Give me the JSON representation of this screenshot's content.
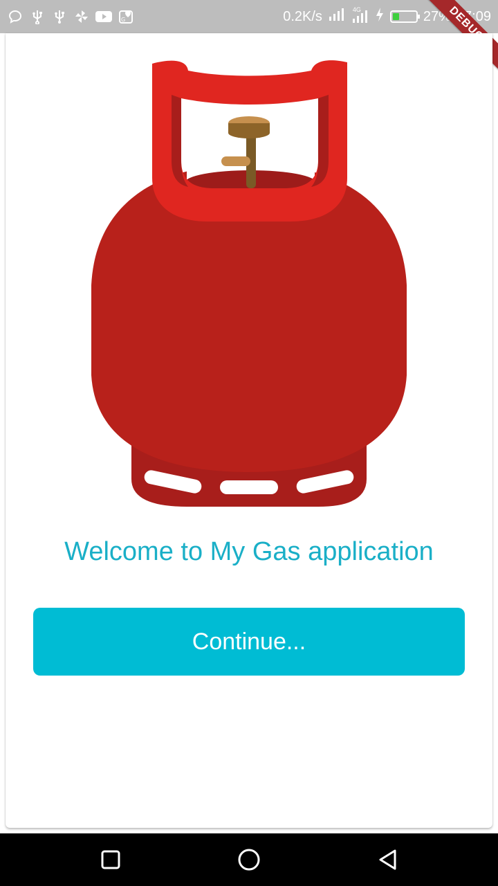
{
  "status_bar": {
    "net_speed": "0.2K/s",
    "network_type": "4G",
    "battery_percent": "27%",
    "battery_level": 0.27,
    "time": "17:09",
    "left_icons": [
      "chat-bubble-icon",
      "usb-icon",
      "usb-icon",
      "pinwheel-icon",
      "youtube-icon",
      "maps-icon"
    ]
  },
  "debug_banner": "DEBUG",
  "main": {
    "welcome_text": "Welcome to My Gas application",
    "continue_label": "Continue..."
  },
  "colors": {
    "accent": "#00bcd4",
    "title": "#1aafc7",
    "cylinder_body": "#b8211b",
    "cylinder_handle": "#e02620"
  },
  "nav_bar": {
    "buttons": [
      "recents-square-icon",
      "home-circle-icon",
      "back-triangle-icon"
    ]
  }
}
